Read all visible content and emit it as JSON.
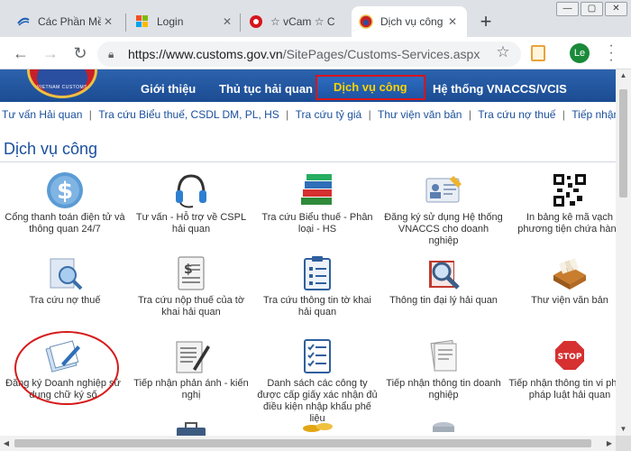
{
  "browser": {
    "tabs": [
      {
        "label": "Các Phần Mề",
        "favicon": "vnpt-icon"
      },
      {
        "label": "Login",
        "favicon": "windows-icon"
      },
      {
        "label": "☆ vCam ☆ C",
        "favicon": "record-icon"
      },
      {
        "label": "Dịch vụ công",
        "favicon": "customs-icon"
      }
    ],
    "close_glyph": "✕",
    "new_tab_glyph": "+",
    "url_host": "https://www.customs.gov.vn",
    "url_path": "/SitePages/Customs-Services.aspx",
    "avatar_initials": "Le",
    "window_buttons": [
      "—",
      "▢",
      "✕"
    ]
  },
  "site": {
    "logo_text": "VIETNAM CUSTOMS",
    "nav": [
      {
        "label": "Giới thiệu"
      },
      {
        "label": "Thủ tục hải quan"
      },
      {
        "label": "Dịch vụ công"
      },
      {
        "label": "Hệ thống VNACCS/VCIS"
      }
    ],
    "links": [
      "Tư vấn Hải quan",
      "Tra cứu Biểu thuế, CSDL DM, PL, HS",
      "Tra cứu tỷ giá",
      "Thư viện văn bản",
      "Tra cứu nợ thuế",
      "Tiếp nhận t"
    ],
    "link_separator": "|",
    "page_title": "Dịch vụ công"
  },
  "services": [
    {
      "label": "Cổng thanh toán điện tử và thông quan 24/7",
      "icon": "dollar-coin-icon"
    },
    {
      "label": "Tư vấn - Hỗ trợ về CSPL hải quan",
      "icon": "headset-icon"
    },
    {
      "label": "Tra cứu Biểu thuế - Phân loại - HS",
      "icon": "books-icon"
    },
    {
      "label": "Đăng ký sử dụng Hệ thống VNACCS cho doanh nghiệp",
      "icon": "id-card-icon"
    },
    {
      "label": "In bảng kê mã vạch phương tiện chứa hàng",
      "icon": "qr-code-icon"
    },
    {
      "label": "Tra cứu nợ thuế",
      "icon": "search-document-icon"
    },
    {
      "label": "Tra cứu nộp thuế của tờ khai hải quan",
      "icon": "tax-document-icon"
    },
    {
      "label": "Tra cứu thông tin tờ khai hải quan",
      "icon": "clipboard-checklist-icon"
    },
    {
      "label": "Thông tin đại lý hải quan",
      "icon": "magnifier-book-icon"
    },
    {
      "label": "Thư viện văn bản",
      "icon": "file-drawer-icon"
    },
    {
      "label": "Đăng ký Doanh nghiệp sử dụng chữ ký số",
      "icon": "notepad-pen-icon"
    },
    {
      "label": "Tiếp nhận phản ánh - kiến nghị",
      "icon": "document-pen-icon"
    },
    {
      "label": "Danh sách các công ty được cấp giấy xác nhận đủ điều kiện nhập khẩu phế liệu",
      "icon": "checklist-icon"
    },
    {
      "label": "Tiếp nhận thông tin doanh nghiệp",
      "icon": "documents-stack-icon"
    },
    {
      "label": "Tiếp nhận thông tin vi phạm pháp luật hải quan",
      "icon": "stop-sign-icon"
    },
    {
      "label": "",
      "icon": "briefcase-icon"
    },
    {
      "label": "",
      "icon": "coins-icon"
    },
    {
      "label": "",
      "icon": "database-icon"
    }
  ],
  "colors": {
    "header_blue": "#1c4c93",
    "link_blue": "#1a4f9c",
    "nav_active_text": "#ffd200",
    "highlight_red": "#d61a1a"
  }
}
